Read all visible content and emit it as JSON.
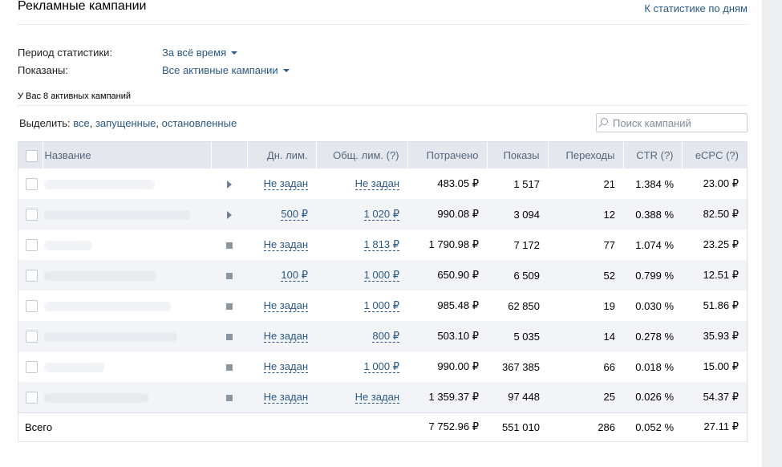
{
  "header": {
    "title": "Рекламные кампании",
    "by_days_link": "К статистике по дням"
  },
  "filters": {
    "period_label": "Период статистики:",
    "period_value": "За всё время",
    "shown_label": "Показаны:",
    "shown_value": "Все активные кампании"
  },
  "active_count_text": "У Вас 8 активных кампаний",
  "select": {
    "label": "Выделить:",
    "all": "все",
    "running": "запущенные",
    "stopped": "остановленные"
  },
  "search": {
    "placeholder": "Поиск кампаний"
  },
  "table": {
    "headers": {
      "name": "Название",
      "daily_limit": "Дн. лим.",
      "total_limit": "Общ. лим. (?)",
      "spent": "Потрачено",
      "impressions": "Показы",
      "clicks": "Переходы",
      "ctr": "CTR (?)",
      "ecpc": "eCPC (?)"
    },
    "rows": [
      {
        "status": "play-icon",
        "daily_limit": "Не задан",
        "total_limit": "Не задан",
        "spent": "483.05 ₽",
        "impressions": "1 517",
        "clicks": "21",
        "ctr": "1.384 %",
        "ecpc": "23.00 ₽"
      },
      {
        "status": "play-icon",
        "daily_limit": "500 ₽",
        "total_limit": "1 020 ₽",
        "spent": "990.08 ₽",
        "impressions": "3 094",
        "clicks": "12",
        "ctr": "0.388 %",
        "ecpc": "82.50 ₽"
      },
      {
        "status": "stop-icon",
        "daily_limit": "Не задан",
        "total_limit": "1 813 ₽",
        "spent": "1 790.98 ₽",
        "impressions": "7 172",
        "clicks": "77",
        "ctr": "1.074 %",
        "ecpc": "23.25 ₽"
      },
      {
        "status": "stop-icon",
        "daily_limit": "100 ₽",
        "total_limit": "1 000 ₽",
        "spent": "650.90 ₽",
        "impressions": "6 509",
        "clicks": "52",
        "ctr": "0.799 %",
        "ecpc": "12.51 ₽"
      },
      {
        "status": "stop-icon",
        "daily_limit": "Не задан",
        "total_limit": "1 000 ₽",
        "spent": "985.48 ₽",
        "impressions": "62 850",
        "clicks": "19",
        "ctr": "0.030 %",
        "ecpc": "51.86 ₽"
      },
      {
        "status": "stop-icon",
        "daily_limit": "Не задан",
        "total_limit": "800 ₽",
        "spent": "503.10 ₽",
        "impressions": "5 035",
        "clicks": "14",
        "ctr": "0.278 %",
        "ecpc": "35.93 ₽"
      },
      {
        "status": "stop-icon",
        "daily_limit": "Не задан",
        "total_limit": "1 000 ₽",
        "spent": "990.00 ₽",
        "impressions": "367 385",
        "clicks": "66",
        "ctr": "0.018 %",
        "ecpc": "15.00 ₽"
      },
      {
        "status": "stop-icon",
        "daily_limit": "Не задан",
        "total_limit": "Не задан",
        "spent": "1 359.37 ₽",
        "impressions": "97 448",
        "clicks": "25",
        "ctr": "0.026 %",
        "ecpc": "54.37 ₽"
      }
    ],
    "totals": {
      "label": "Всего",
      "spent": "7 752.96 ₽",
      "impressions": "551 010",
      "clicks": "286",
      "ctr": "0.052 %",
      "ecpc": "27.11 ₽"
    }
  },
  "colors": {
    "link": "#2a5885",
    "header_bg": "#e4e8ee",
    "stripe": "#f2f4f7",
    "page_bg": "#edeef0"
  }
}
